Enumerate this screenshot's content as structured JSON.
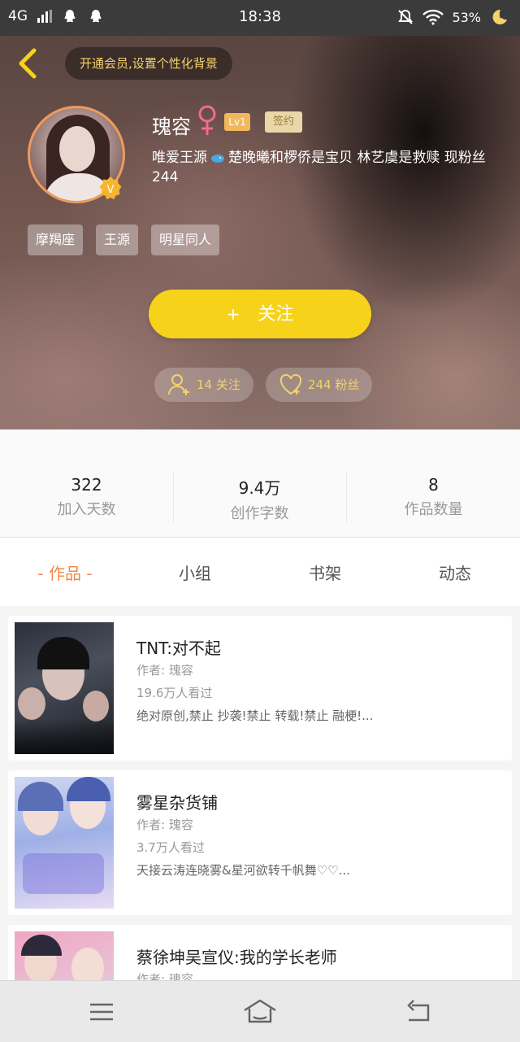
{
  "status_bar": {
    "network": "4G",
    "time": "18:38",
    "battery": "53%"
  },
  "header": {
    "vip_prompt": "开通会员,设置个性化背景"
  },
  "profile": {
    "name": "瑰容",
    "level": "Lv1",
    "sign_label": "签约",
    "bio_part1": "唯爱王源",
    "bio_part2": "楚晚曦和椤侨是宝贝 林艺虞是救赎 现粉丝244",
    "tags": [
      "摩羯座",
      "王源",
      "明星同人"
    ],
    "follow_label": "关注",
    "follow_plus": "+",
    "following": "14 关注",
    "fans": "244 粉丝"
  },
  "stats": [
    {
      "value": "322",
      "label": "加入天数"
    },
    {
      "value": "9.4万",
      "label": "创作字数"
    },
    {
      "value": "8",
      "label": "作品数量"
    }
  ],
  "tabs": [
    {
      "label": "- 作品 -",
      "active": true
    },
    {
      "label": "小组",
      "active": false
    },
    {
      "label": "书架",
      "active": false
    },
    {
      "label": "动态",
      "active": false
    }
  ],
  "works": [
    {
      "title": "TNT:对不起",
      "author": "作者: 瑰容",
      "views": "19.6万人看过",
      "desc": "绝对原创,禁止 抄袭!禁止 转载!禁止 融梗!..."
    },
    {
      "title": "雾星杂货铺",
      "author": "作者: 瑰容",
      "views": "3.7万人看过",
      "desc": "天接云涛连晓雾&星河欲转千帆舞♡♡..."
    },
    {
      "title": "蔡徐坤吴宣仪:我的学长老师",
      "author": "作者: 瑰容",
      "views": "",
      "desc": ""
    }
  ],
  "colors": {
    "accent": "#f08a47",
    "follow_button": "#f7d21b",
    "gold": "#f3d36a"
  },
  "icons": [
    "back-icon",
    "female-icon",
    "v-badge-icon",
    "add-user-icon",
    "heart-icon",
    "menu-icon",
    "home-icon",
    "return-icon"
  ]
}
